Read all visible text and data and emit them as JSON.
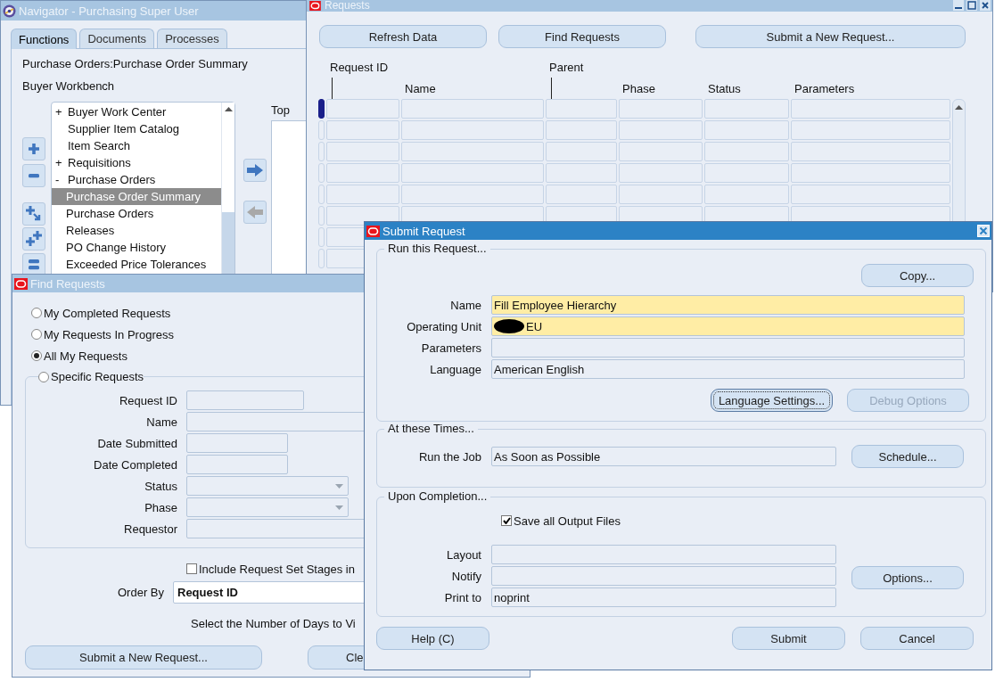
{
  "navigator": {
    "title": "Navigator - Purchasing Super User",
    "tabs": [
      {
        "label": "Functions",
        "selected": true
      },
      {
        "label": "Documents",
        "selected": false
      },
      {
        "label": "Processes",
        "selected": false
      }
    ],
    "path": "Purchase Orders:Purchase Order Summary",
    "responsibility": "Buyer Workbench",
    "tree": [
      {
        "toggle": "+",
        "label": "Buyer Work Center",
        "selected": false
      },
      {
        "label": "Supplier Item Catalog",
        "selected": false
      },
      {
        "label": "Item Search",
        "selected": false
      },
      {
        "toggle": "+",
        "label": "Requisitions",
        "selected": false
      },
      {
        "toggle": "-",
        "label": "Purchase Orders",
        "selected": false,
        "children": [
          {
            "label": "Purchase Order Summary",
            "selected": true
          },
          {
            "label": "Purchase Orders",
            "selected": false
          },
          {
            "label": "Releases",
            "selected": false
          },
          {
            "label": "PO Change History",
            "selected": false
          },
          {
            "label": "Exceeded Price Tolerances",
            "selected": false
          }
        ]
      }
    ],
    "top_label": "Top"
  },
  "requests_window": {
    "title": "Requests",
    "buttons": [
      "Refresh Data",
      "Find Requests",
      "Submit a New Request..."
    ],
    "columns": [
      "Request ID",
      "Name",
      "Parent",
      "Phase",
      "Status",
      "Parameters"
    ]
  },
  "find_requests": {
    "title": "Find Requests",
    "options": [
      {
        "label": "My Completed Requests",
        "selected": false
      },
      {
        "label": "My Requests In Progress",
        "selected": false
      },
      {
        "label": "All My Requests",
        "selected": true
      },
      {
        "label": "Specific Requests",
        "selected": false
      }
    ],
    "criteria": [
      {
        "label": "Request ID",
        "kind": "text"
      },
      {
        "label": "Name",
        "kind": "text"
      },
      {
        "label": "Date Submitted",
        "kind": "text"
      },
      {
        "label": "Date Completed",
        "kind": "text"
      },
      {
        "label": "Status",
        "kind": "dropdown"
      },
      {
        "label": "Phase",
        "kind": "dropdown"
      },
      {
        "label": "Requestor",
        "kind": "text"
      }
    ],
    "include_stages": {
      "label": "Include Request Set Stages in",
      "checked": false
    },
    "order_by": {
      "label": "Order By",
      "value": "Request ID"
    },
    "days_prompt": "Select the Number of Days to Vi",
    "buttons": [
      "Submit a New Request...",
      "Cle"
    ]
  },
  "submit_request": {
    "title": "Submit Request",
    "run_section": {
      "title": "Run this Request...",
      "copy_button": "Copy...",
      "fields": [
        {
          "label": "Name",
          "value": "Fill Employee Hierarchy",
          "required": true
        },
        {
          "label": "Operating Unit",
          "value": "EU",
          "required": true,
          "redacted": true
        },
        {
          "label": "Parameters",
          "required": false
        },
        {
          "label": "Language",
          "value": "American English",
          "required": false
        }
      ],
      "buttons": [
        {
          "label": "Language Settings...",
          "focused": true,
          "disabled": false
        },
        {
          "label": "Debug Options",
          "focused": false,
          "disabled": true
        }
      ]
    },
    "times_section": {
      "title": "At these Times...",
      "label": "Run the Job",
      "value": "As Soon as Possible",
      "button": "Schedule..."
    },
    "completion_section": {
      "title": "Upon Completion...",
      "save_output": {
        "label": "Save all Output Files",
        "checked": true
      },
      "fields": [
        {
          "label": "Layout"
        },
        {
          "label": "Notify"
        },
        {
          "label": "Print to",
          "value": "noprint"
        }
      ],
      "button": "Options..."
    },
    "buttons": [
      "Help (C)",
      "Submit",
      "Cancel"
    ]
  }
}
